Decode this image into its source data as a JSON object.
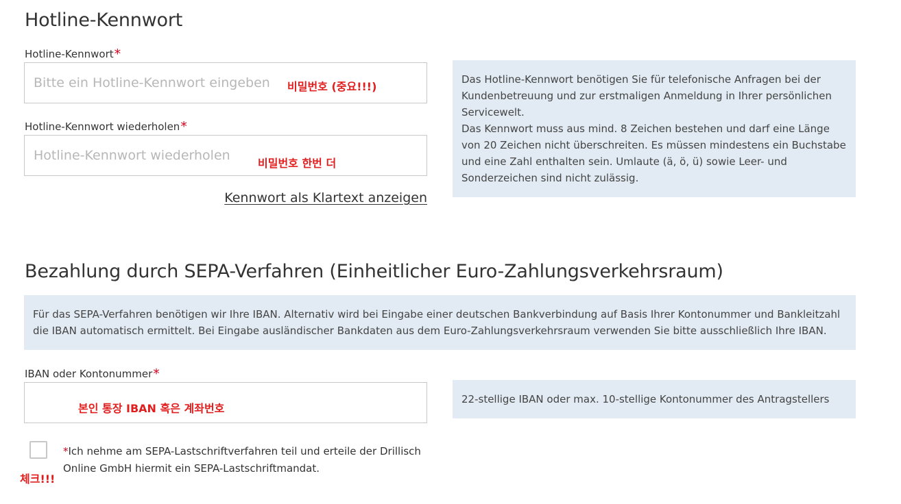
{
  "hotline": {
    "heading": "Hotline-Kennwort",
    "password_label": "Hotline-Kennwort",
    "password_placeholder": "Bitte ein Hotline-Kennwort eingeben",
    "password_annotation": "비밀번호 (중요!!!)",
    "repeat_label": "Hotline-Kennwort wiederholen",
    "repeat_placeholder": "Hotline-Kennwort wiederholen",
    "repeat_annotation": "비밀번호 한번 더",
    "show_plaintext_link": "Kennwort als Klartext anzeigen",
    "required_marker": "*",
    "info_line1": "Das Hotline-Kennwort benötigen Sie für telefonische Anfragen bei der Kundenbetreuung und zur erstmaligen Anmeldung in Ihrer persönlichen Servicewelt.",
    "info_line2": "Das Kennwort muss aus mind. 8 Zeichen bestehen und darf eine Länge von 20 Zeichen nicht überschreiten. Es müssen mindestens ein Buchstabe und eine Zahl enthalten sein. Umlaute (ä, ö, ü) sowie Leer- und Sonderzeichen sind nicht zulässig."
  },
  "sepa": {
    "heading": "Bezahlung durch SEPA-Verfahren (Einheitlicher Euro-Zahlungsverkehrsraum)",
    "info": "Für das SEPA-Verfahren benötigen wir Ihre IBAN. Alternativ wird bei Eingabe einer deutschen Bankverbindung auf Basis Ihrer Kontonummer und Bankleitzahl die IBAN automatisch ermittelt. Bei Eingabe ausländischer Bankdaten aus dem Euro-Zahlungsverkehrsraum verwenden Sie bitte ausschließlich Ihre IBAN.",
    "iban_label": "IBAN oder Kontonummer",
    "iban_annotation": "본인 통장 IBAN 혹은 계좌번호",
    "iban_hint": "22-stellige IBAN oder max. 10-stellige Kontonummer des Antragstellers",
    "required_marker": "*",
    "mandate_star": "*",
    "mandate_text": "Ich nehme am SEPA-Lastschriftverfahren teil und erteile der Drillisch Online GmbH hiermit ein SEPA-Lastschriftmandat.",
    "checkbox_annotation": "체크!!!"
  },
  "colors": {
    "required": "#d0021b",
    "annotation": "#e01e1e",
    "info_bg": "#e2ebf3",
    "input_border": "#c8c8c8"
  }
}
